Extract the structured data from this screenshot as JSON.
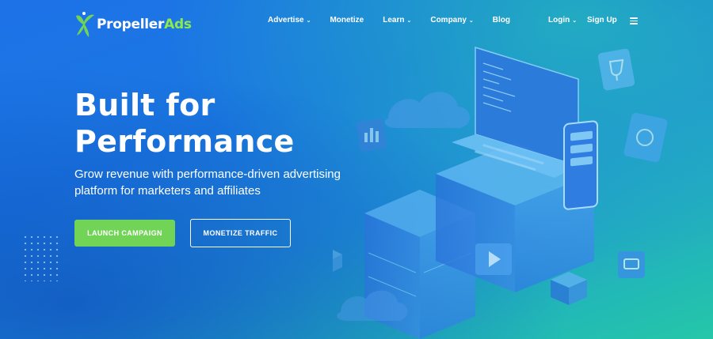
{
  "brand": {
    "name_part1": "Propeller",
    "name_part2": "Ads"
  },
  "nav": [
    {
      "label": "Advertise",
      "has_dropdown": true
    },
    {
      "label": "Monetize",
      "has_dropdown": false
    },
    {
      "label": "Learn",
      "has_dropdown": true
    },
    {
      "label": "Company",
      "has_dropdown": true
    },
    {
      "label": "Blog",
      "has_dropdown": false
    }
  ],
  "auth": {
    "login_label": "Login",
    "signup_label": "Sign Up"
  },
  "hero": {
    "title_line1": "Built for",
    "title_line2": "Performance",
    "subtitle": "Grow revenue with performance-driven advertising platform for marketers and affiliates",
    "primary_cta": "LAUNCH CAMPAIGN",
    "secondary_cta": "MONETIZE TRAFFIC"
  },
  "colors": {
    "primary_button": "#72d457",
    "logo_accent": "#8ee94a",
    "background_start": "#1d72e8",
    "background_end": "#25c7a8"
  },
  "icons": [
    "propeller-logo-icon",
    "chevron-down-icon",
    "hamburger-menu-icon",
    "laptop-icon",
    "phone-icon",
    "cloud-icon",
    "trophy-icon",
    "chat-icon",
    "play-icon",
    "box-icon",
    "server-icon"
  ]
}
